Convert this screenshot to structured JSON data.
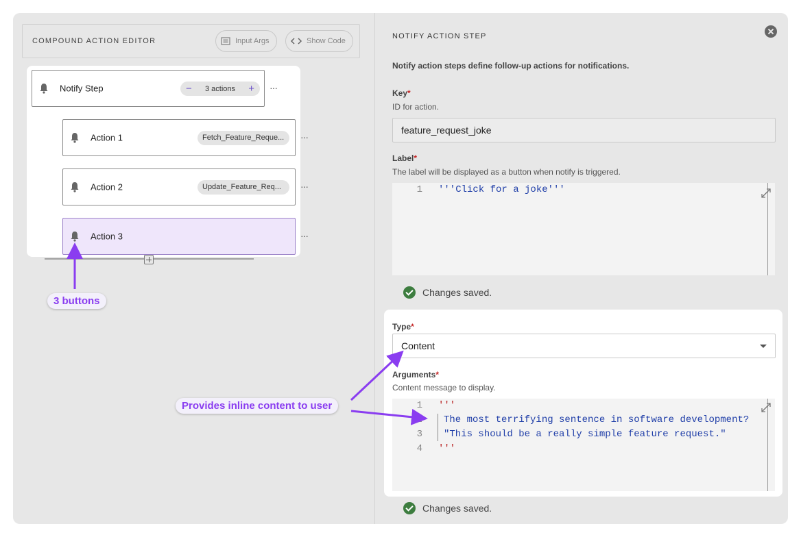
{
  "left": {
    "title": "COMPOUND ACTION EDITOR",
    "input_args_label": "Input Args",
    "show_code_label": "Show Code",
    "root_node": {
      "label": "Notify Step",
      "count_label": "3 actions",
      "minus": "−",
      "plus": "+"
    },
    "children": [
      {
        "label": "Action 1",
        "chip": "Fetch_Feature_Reque..."
      },
      {
        "label": "Action 2",
        "chip": "Update_Feature_Req..."
      },
      {
        "label": "Action 3",
        "chip": ""
      }
    ],
    "more_glyph": "···"
  },
  "right": {
    "title": "NOTIFY ACTION STEP",
    "description": "Notify action steps define follow-up actions for notifications.",
    "key": {
      "label": "Key",
      "required": "*",
      "help": "ID for action.",
      "value": "feature_request_joke"
    },
    "label_field": {
      "label": "Label",
      "required": "*",
      "help": "The label will be displayed as a button when notify is triggered.",
      "line_numbers": [
        "1"
      ],
      "lines": [
        "'''Click for a joke'''"
      ]
    },
    "saved_text": "Changes saved.",
    "type_field": {
      "label": "Type",
      "required": "*",
      "value": "Content"
    },
    "arguments_field": {
      "label": "Arguments",
      "required": "*",
      "help": "Content message to display.",
      "line_numbers": [
        "1",
        "2",
        "3",
        "4"
      ],
      "line_1": "'''",
      "line_2": "The most terrifying sentence in software development?",
      "line_3": "\"This should be a really simple feature request.\"",
      "line_4": "'''"
    },
    "saved_text_2": "Changes saved."
  },
  "annotations": {
    "buttons_callout": "3 buttons",
    "content_callout": "Provides inline content to user",
    "accent_color": "#8a3df0"
  }
}
